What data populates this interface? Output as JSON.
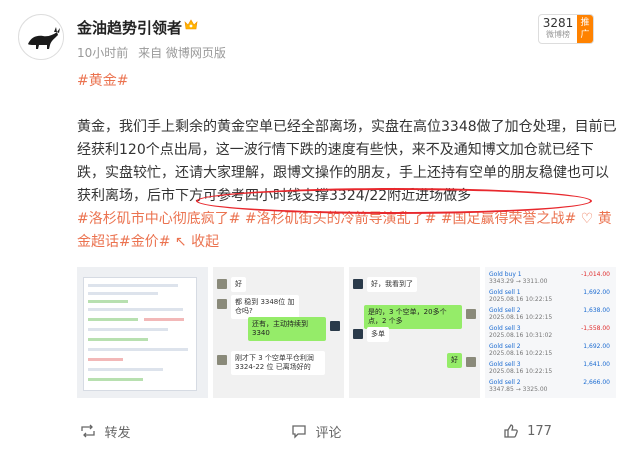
{
  "user": {
    "name": "金油趋势引领者",
    "time": "10小时前",
    "source": "来自 微博网页版"
  },
  "rank": {
    "number": "3281",
    "subtitle": "微博榜",
    "tag": "推广"
  },
  "topic_tag": "#黄金#",
  "post": {
    "text_main": "黄金，我们手上剩余的黄金空单已经全部离场，实盘在高位3348做了加仓处理，目前已经获利120个点出局，这一波行情下跌的速度有些快，来不及通知博文加仓就已经下跌，实盘较忙，还请大家理解，跟博文操作的朋友，手上还持有空单的朋友稳健也可以获利离场，后市下方可参考四小时线支撑3324/22附近进场做多",
    "hashtags": "#洛杉矶市中心彻底疯了# #洛杉矶街头的冷箭导演乱了# #国足赢得荣誉之战#",
    "super_topic": "黄金超话",
    "price_tag": "#金价#",
    "collapse": "收起"
  },
  "images": {
    "chat1": {
      "msg1": "好",
      "msg2": "都 稳到 3348位 加仓吗?",
      "msg3": "还有，主动持续到 3340",
      "msg4": "刚才下 3 个空单平仓利润 3324-22 位 已离场好的"
    },
    "chat2": {
      "msg1": "好，我看到了",
      "msg2": "是的，3 个空单，20多个点，2 个多",
      "msg3": "多单",
      "msg4": "好"
    },
    "trades": [
      {
        "label": "Gold buy 1",
        "value": "-1,014.00",
        "sub": "3343.29 → 3311.00",
        "red": true
      },
      {
        "label": "Gold sell 1",
        "value": "1,692.00",
        "sub": "2025.08.16 10:22:15",
        "red": false
      },
      {
        "label": "Gold sell 2",
        "value": "1,638.00",
        "sub": "2025.08.16 10:22:15",
        "red": false
      },
      {
        "label": "Gold sell 3",
        "value": "-1,558.00",
        "sub": "2025.08.16 10:31:02",
        "red": true
      },
      {
        "label": "Gold sell 2",
        "value": "1,692.00",
        "sub": "2025.08.16 10:22:15",
        "red": false
      },
      {
        "label": "Gold sell 3",
        "value": "1,641.00",
        "sub": "2025.08.16 10:22:15",
        "red": false
      },
      {
        "label": "Gold sell 2",
        "value": "2,666.00",
        "sub": "3347.85 → 3325.00",
        "red": false
      }
    ]
  },
  "actions": {
    "repost": "转发",
    "comment": "评论",
    "like_count": "177"
  },
  "colors": {
    "link": "#eb7350",
    "highlight": "#e8282d",
    "accent": "#ff8200"
  }
}
